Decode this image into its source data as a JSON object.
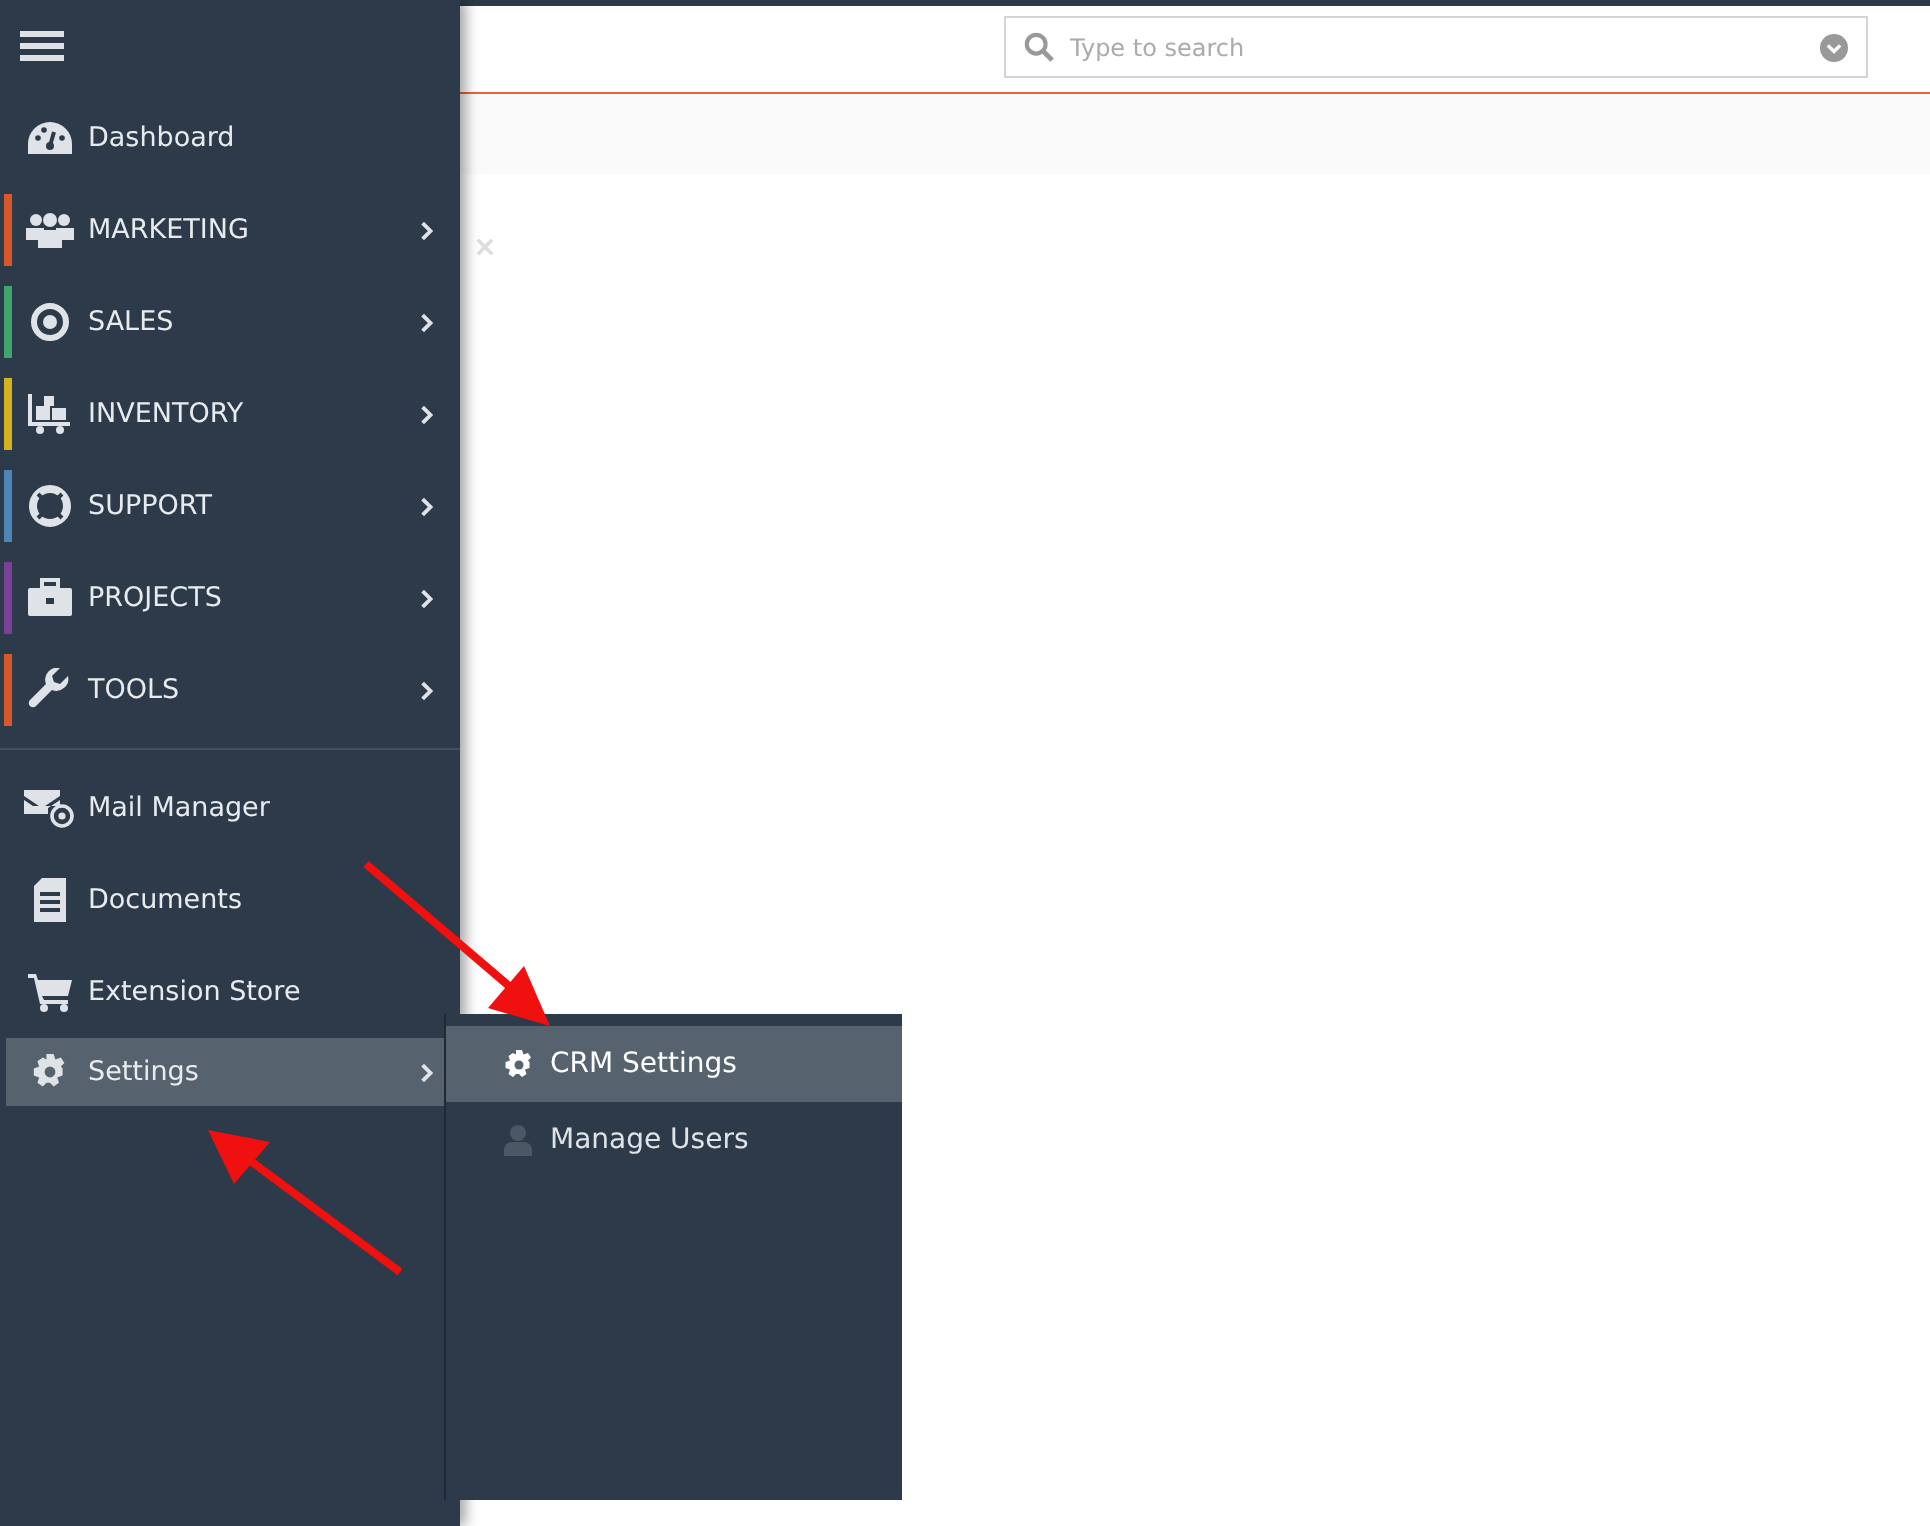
{
  "sidebar": {
    "items": [
      {
        "label": "Dashboard",
        "kind": "plain",
        "selected": false
      },
      {
        "label": "MARKETING",
        "kind": "module",
        "color": "#d9582b",
        "selected": false
      },
      {
        "label": "SALES",
        "kind": "module",
        "color": "#3fa56d",
        "selected": false
      },
      {
        "label": "INVENTORY",
        "kind": "module",
        "color": "#d6b21f",
        "selected": false
      },
      {
        "label": "SUPPORT",
        "kind": "module",
        "color": "#4f86b8",
        "selected": false
      },
      {
        "label": "PROJECTS",
        "kind": "module",
        "color": "#7c3f98",
        "selected": false
      },
      {
        "label": "TOOLS",
        "kind": "module",
        "color": "#d9582b",
        "selected": false
      },
      {
        "label": "Mail Manager",
        "kind": "plain",
        "selected": false
      },
      {
        "label": "Documents",
        "kind": "plain",
        "selected": false
      },
      {
        "label": "Extension Store",
        "kind": "plain",
        "selected": false
      },
      {
        "label": "Settings",
        "kind": "menu",
        "selected": true
      }
    ]
  },
  "submenu": {
    "items": [
      {
        "label": "CRM Settings",
        "selected": true
      },
      {
        "label": "Manage Users",
        "selected": false
      }
    ]
  },
  "search": {
    "placeholder": "Type to search"
  }
}
